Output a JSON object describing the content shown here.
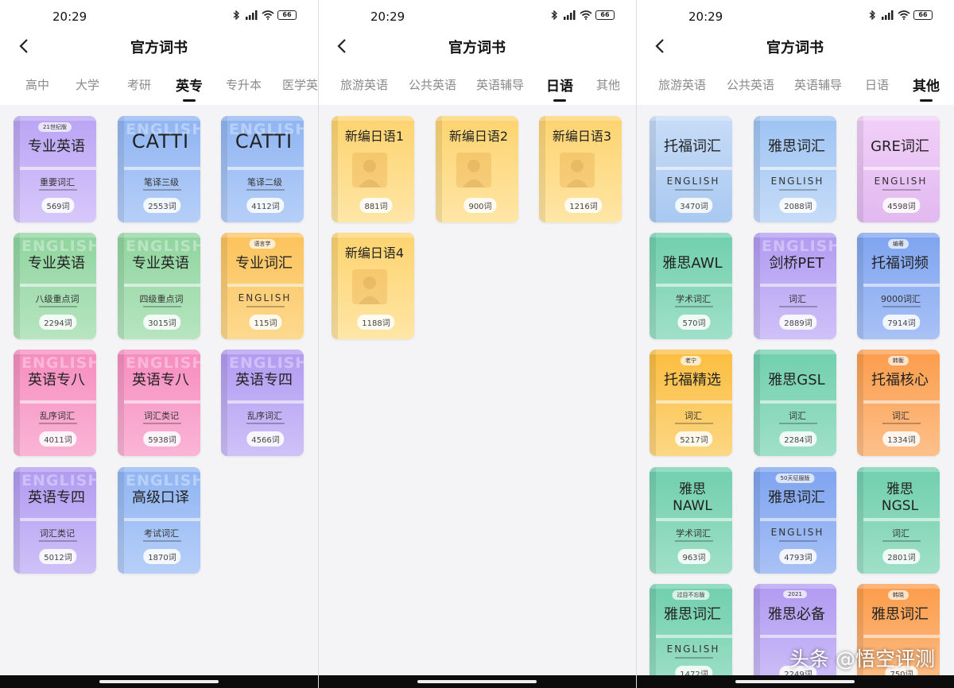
{
  "status": {
    "time": "20:29",
    "battery": "66"
  },
  "title": "官方词书",
  "watermark": "头条 @悟空评测",
  "panels": [
    {
      "tabs": [
        "高中",
        "大学",
        "考研",
        "英专",
        "专升本",
        "医学英"
      ],
      "active": 3,
      "books": [
        {
          "badge": "21世纪版",
          "title": "专业英语",
          "sub": "重要词汇",
          "count": "569词",
          "color": "c-purple"
        },
        {
          "wm": "ENGLISH",
          "title": "CATTI",
          "sub": "笔译三级",
          "count": "2553词",
          "color": "c-blue",
          "big": true
        },
        {
          "wm": "ENGLISH",
          "title": "CATTI",
          "sub": "笔译二级",
          "count": "4112词",
          "color": "c-blue",
          "big": true
        },
        {
          "wm": "ENGLISH",
          "title": "专业英语",
          "sub": "八级重点词",
          "count": "2294词",
          "color": "c-green"
        },
        {
          "wm": "ENGLISH",
          "title": "专业英语",
          "sub": "四级重点词",
          "count": "3015词",
          "color": "c-green"
        },
        {
          "badge": "语言学",
          "title": "专业词汇",
          "sub": "ENGLISH",
          "count": "115词",
          "color": "c-orange",
          "en": true
        },
        {
          "wm": "ENGLISH",
          "title": "英语专八",
          "sub": "乱序词汇",
          "count": "4011词",
          "color": "c-pink"
        },
        {
          "wm": "ENGLISH",
          "title": "英语专八",
          "sub": "词汇类记",
          "count": "5938词",
          "color": "c-pink"
        },
        {
          "wm": "ENGLISH",
          "title": "英语专四",
          "sub": "乱序词汇",
          "count": "4566词",
          "color": "c-violet"
        },
        {
          "wm": "ENGLISH",
          "title": "英语专四",
          "sub": "词汇类记",
          "count": "5012词",
          "color": "c-violet"
        },
        {
          "wm": "ENGLISH",
          "title": "高级口译",
          "sub": "考试词汇",
          "count": "1870词",
          "color": "c-blue"
        }
      ]
    },
    {
      "tabs": [
        "旅游英语",
        "公共英语",
        "英语辅导",
        "日语",
        "其他"
      ],
      "active": 3,
      "books": [
        {
          "title": "新编日语1",
          "count": "881词",
          "color": "c-yellow",
          "jp": true
        },
        {
          "title": "新编日语2",
          "count": "900词",
          "color": "c-yellow",
          "jp": true
        },
        {
          "title": "新编日语3",
          "count": "1216词",
          "color": "c-yellow",
          "jp": true
        },
        {
          "title": "新编日语4",
          "count": "1188词",
          "color": "c-yellow",
          "jp": true
        }
      ]
    },
    {
      "tabs": [
        "旅游英语",
        "公共英语",
        "英语辅导",
        "日语",
        "其他"
      ],
      "active": 4,
      "books": [
        {
          "title": "托福词汇",
          "sub": "ENGLISH",
          "count": "3470词",
          "color": "c-lightblue",
          "en": true
        },
        {
          "title": "雅思词汇",
          "sub": "ENGLISH",
          "count": "2088词",
          "color": "c-skyblue",
          "en": true
        },
        {
          "title": "GRE词汇",
          "sub": "ENGLISH",
          "count": "4598词",
          "color": "c-lilac",
          "en": true
        },
        {
          "title": "雅思AWL",
          "sub": "学术词汇",
          "count": "570词",
          "color": "c-teal"
        },
        {
          "wm": "ENGLISH",
          "title": "剑桥PET",
          "sub": "词汇",
          "count": "2889词",
          "color": "c-violet"
        },
        {
          "badge": "编著",
          "title": "托福词频",
          "sub": "9000词汇",
          "count": "7914词",
          "color": "c-royal"
        },
        {
          "badge": "老宁",
          "title": "托福精选",
          "sub": "词汇",
          "count": "5217词",
          "color": "c-gold"
        },
        {
          "title": "雅思GSL",
          "sub": "词汇",
          "count": "2284词",
          "color": "c-teal"
        },
        {
          "badge": "韩衡",
          "title": "托福核心",
          "sub": "词汇",
          "count": "1334词",
          "color": "c-tangerine"
        },
        {
          "title": "雅思\nNAWL",
          "sub": "学术词汇",
          "count": "963词",
          "color": "c-teal",
          "two": true
        },
        {
          "badge": "50天征服版",
          "title": "雅思词汇",
          "sub": "ENGLISH",
          "count": "4793词",
          "color": "c-royal",
          "en": true
        },
        {
          "title": "雅思\nNGSL",
          "sub": "词汇",
          "count": "2801词",
          "color": "c-teal",
          "two": true
        },
        {
          "badge": "过目不忘版",
          "title": "雅思词汇",
          "sub": "ENGLISH",
          "count": "1472词",
          "color": "c-teal",
          "en": true
        },
        {
          "badge": "2021",
          "title": "雅思必备",
          "sub": "",
          "count": "2249词",
          "color": "c-violet"
        },
        {
          "badge": "韩晓",
          "title": "雅思词汇",
          "sub": "",
          "count": "750词",
          "color": "c-tangerine"
        }
      ]
    }
  ]
}
